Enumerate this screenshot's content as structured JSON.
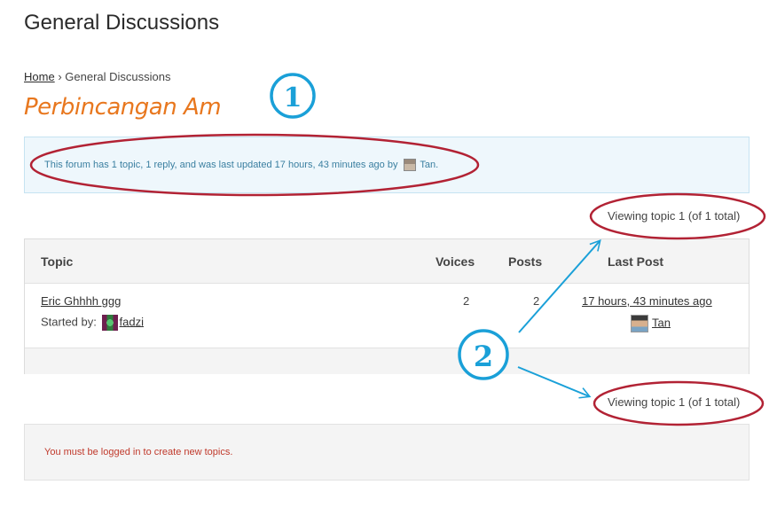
{
  "page": {
    "title": "General Discussions"
  },
  "breadcrumb": {
    "home": "Home",
    "separator": "›",
    "current": "General Discussions"
  },
  "forum": {
    "heading": "Perbincangan Am"
  },
  "info": {
    "text": "This forum has 1 topic, 1 reply, and was last updated 17 hours, 43 minutes ago by",
    "author": "Tan"
  },
  "pagination": {
    "top": "Viewing topic 1 (of 1 total)",
    "bottom": "Viewing topic 1 (of 1 total)"
  },
  "table": {
    "headers": {
      "topic": "Topic",
      "voices": "Voices",
      "posts": "Posts",
      "last_post": "Last Post"
    },
    "rows": [
      {
        "title": "Eric Ghhhh ggg",
        "started_by_label": "Started by:",
        "author": "fadzi",
        "voices": "2",
        "posts": "2",
        "last_post_time": "17 hours, 43 minutes ago",
        "last_post_author": "Tan"
      }
    ]
  },
  "notice": {
    "text": "You must be logged in to create new topics."
  },
  "annotations": {
    "marker_1": "1",
    "marker_2": "2"
  },
  "colors": {
    "heading_orange": "#e8771e",
    "info_bg": "#eef7fc",
    "annotation_red": "#b22234",
    "annotation_blue": "#1aa0d8",
    "notice_red": "#c0392b"
  }
}
